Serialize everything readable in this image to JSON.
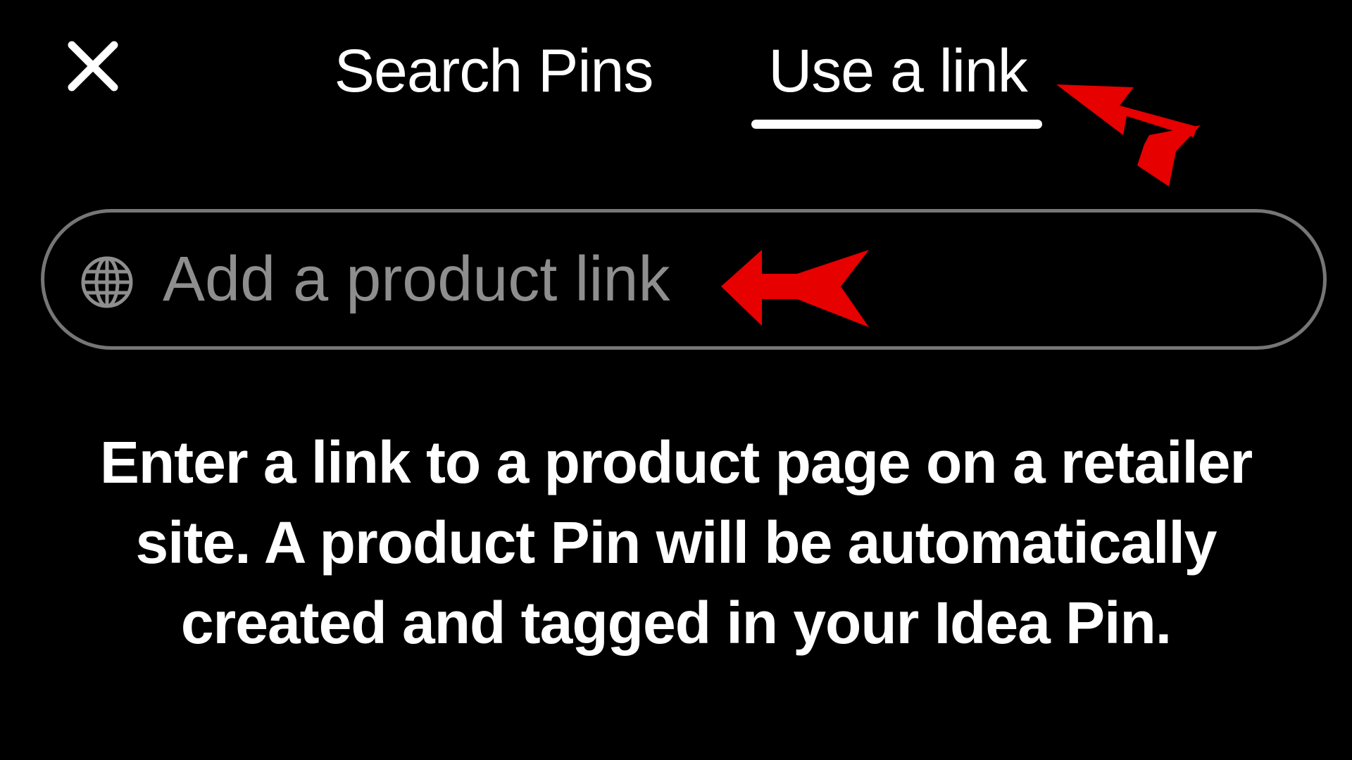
{
  "header": {
    "close_icon": "close-icon",
    "tabs": [
      {
        "label": "Search Pins",
        "active": false
      },
      {
        "label": "Use a link",
        "active": true
      }
    ]
  },
  "link_field": {
    "icon": "globe-icon",
    "placeholder": "Add a product link"
  },
  "description": "Enter a link to a product page on a retailer site. A product Pin will be automatically created and tagged in your Idea Pin.",
  "annotations": {
    "arrow_color": "#e60000",
    "arrows": [
      "arrow-to-use-a-link-tab",
      "arrow-to-product-link-field"
    ]
  },
  "colors": {
    "background": "#000000",
    "text": "#ffffff",
    "placeholder": "#8e8e8e",
    "field_border": "#767676"
  }
}
